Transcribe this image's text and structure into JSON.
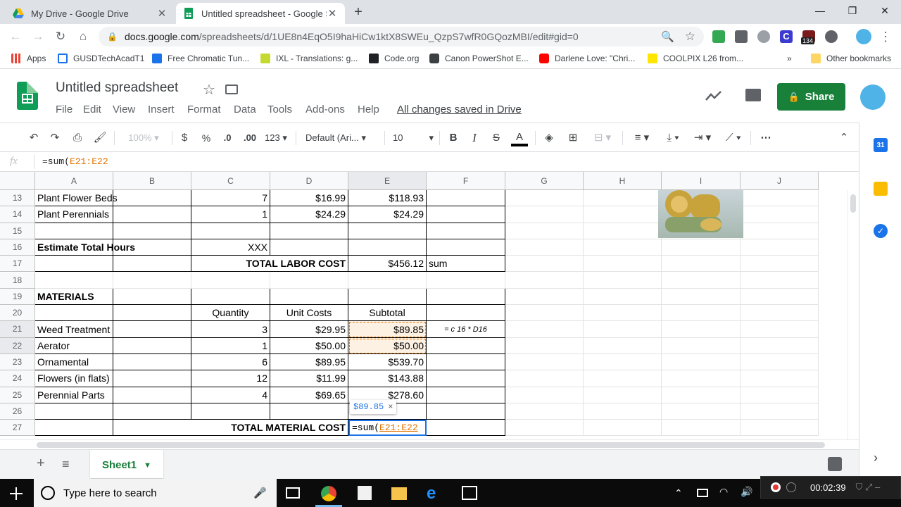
{
  "browser": {
    "tabs": [
      {
        "title": "My Drive - Google Drive",
        "active": false
      },
      {
        "title": "Untitled spreadsheet - Google Sh",
        "active": true
      }
    ],
    "url_host": "docs.google.com",
    "url_path": "/spreadsheets/d/1UE8n4EqO5I9haHiCw1ktX8SWEu_QzpS7wfR0GQozMBI/edit#gid=0",
    "ext_badge": "134",
    "bookmarks": [
      "Apps",
      "GUSDTechAcadT1",
      "Free Chromatic Tun...",
      "IXL - Translations: g...",
      "Code.org",
      "Canon PowerShot E...",
      "Darlene Love: \"Chri...",
      "COOLPIX L26 from..."
    ],
    "bookmarks_overflow": "»",
    "other_bookmarks": "Other bookmarks"
  },
  "doc": {
    "title": "Untitled spreadsheet",
    "menus": [
      "File",
      "Edit",
      "View",
      "Insert",
      "Format",
      "Data",
      "Tools",
      "Add-ons",
      "Help"
    ],
    "saved_status": "All changes saved in Drive",
    "share_label": "Share"
  },
  "toolbar": {
    "zoom": "100%",
    "currency": "$",
    "percent": "%",
    "dec_less": ".0",
    "dec_more": ".00",
    "number_format": "123",
    "font": "Default (Ari...",
    "font_size": "10",
    "bold": "B",
    "italic": "I",
    "strike": "S",
    "text_color": "A"
  },
  "formula_bar": {
    "fx": "fx",
    "prefix": "=sum(",
    "ref": "E21:E22"
  },
  "columns": [
    "A",
    "B",
    "C",
    "D",
    "E",
    "F",
    "G",
    "H",
    "I",
    "J"
  ],
  "rows": [
    {
      "n": "13",
      "A": "Plant Flower Beds",
      "C": "7",
      "D": "$16.99",
      "E": "$118.93",
      "F": ""
    },
    {
      "n": "14",
      "A": "Plant Perennials",
      "C": "1",
      "D": "$24.29",
      "E": "$24.29",
      "F": ""
    },
    {
      "n": "15",
      "A": "",
      "C": "",
      "D": "",
      "E": "",
      "F": ""
    },
    {
      "n": "16",
      "A": "Estimate Total Hours",
      "C": "XXX",
      "D": "",
      "E": "",
      "F": ""
    },
    {
      "n": "17",
      "A": "",
      "C": "TOTAL LABOR COST",
      "D": "",
      "E": "$456.12",
      "F": "sum"
    },
    {
      "n": "18",
      "A": "",
      "C": "",
      "D": "",
      "E": "",
      "F": ""
    },
    {
      "n": "19",
      "A": "MATERIALS",
      "C": "",
      "D": "",
      "E": "",
      "F": ""
    },
    {
      "n": "20",
      "A": "",
      "C": "Quantity",
      "D": "Unit Costs",
      "E": "Subtotal",
      "F": ""
    },
    {
      "n": "21",
      "A": "Weed Treatment",
      "C": "3",
      "D": "$29.95",
      "E": "$89.85",
      "F": "= c 16 * D16"
    },
    {
      "n": "22",
      "A": "Aerator",
      "C": "1",
      "D": "$50.00",
      "E": "$50.00",
      "F": ""
    },
    {
      "n": "23",
      "A": "Ornamental",
      "C": "6",
      "D": "$89.95",
      "E": "$539.70",
      "F": ""
    },
    {
      "n": "24",
      "A": "Flowers (in flats)",
      "C": "12",
      "D": "$11.99",
      "E": "$143.88",
      "F": ""
    },
    {
      "n": "25",
      "A": "Perennial Parts",
      "C": "4",
      "D": "$69.65",
      "E": "$278.60",
      "F": ""
    },
    {
      "n": "26",
      "A": "",
      "C": "",
      "D": "",
      "E": "",
      "F": ""
    },
    {
      "n": "27",
      "A": "",
      "C": "TOTAL MATERIAL COST",
      "D": "",
      "E": "=sum(E21:E22",
      "F": ""
    }
  ],
  "editing_cell": {
    "prefix": "=sum(",
    "ref": "E21:E22"
  },
  "tooltip": {
    "value": "$89.85",
    "close": "×"
  },
  "sheet_tab": "Sheet1",
  "side_panel": {
    "calendar": "31"
  },
  "taskbar": {
    "search_placeholder": "Type here to search",
    "recording_time": "00:02:39"
  }
}
